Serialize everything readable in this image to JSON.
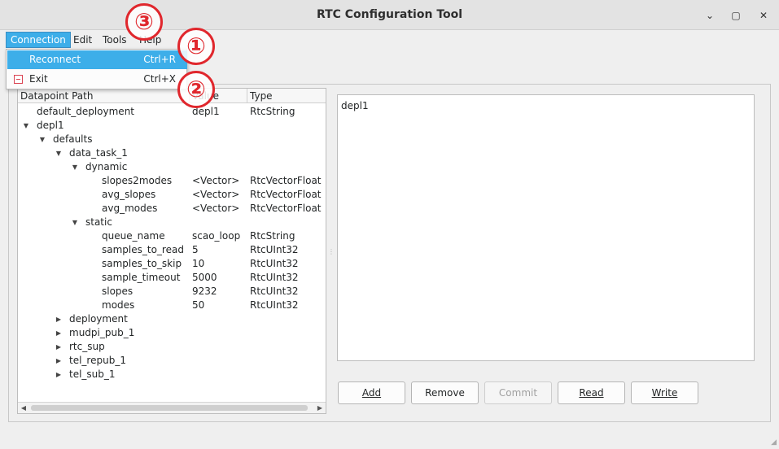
{
  "window": {
    "title": "RTC Configuration Tool",
    "minimize": "⌄",
    "maximize": "▢",
    "close": "✕"
  },
  "menubar": {
    "items": [
      "Connection",
      "Edit",
      "Tools",
      "Help"
    ],
    "active": "Connection"
  },
  "connection_menu": {
    "items": [
      {
        "label": "Reconnect",
        "shortcut": "Ctrl+R",
        "highlighted": true
      },
      {
        "label": "Exit",
        "shortcut": "Ctrl+X",
        "icon": "exit-icon"
      }
    ]
  },
  "tree": {
    "headers": [
      "Datapoint Path",
      "Value",
      "Type"
    ],
    "rows": [
      {
        "name": "default_deployment",
        "value": "depl1",
        "type": "RtcString",
        "depth": 0,
        "arrow": ""
      },
      {
        "name": "depl1",
        "value": "",
        "type": "",
        "depth": 0,
        "arrow": "▼"
      },
      {
        "name": "defaults",
        "value": "",
        "type": "",
        "depth": 1,
        "arrow": "▼"
      },
      {
        "name": "data_task_1",
        "value": "",
        "type": "",
        "depth": 2,
        "arrow": "▼"
      },
      {
        "name": "dynamic",
        "value": "",
        "type": "",
        "depth": 3,
        "arrow": "▼"
      },
      {
        "name": "slopes2modes",
        "value": "<Vector>",
        "type": "RtcVectorFloat",
        "depth": 4,
        "arrow": ""
      },
      {
        "name": "avg_slopes",
        "value": "<Vector>",
        "type": "RtcVectorFloat",
        "depth": 4,
        "arrow": ""
      },
      {
        "name": "avg_modes",
        "value": "<Vector>",
        "type": "RtcVectorFloat",
        "depth": 4,
        "arrow": ""
      },
      {
        "name": "static",
        "value": "",
        "type": "",
        "depth": 3,
        "arrow": "▼"
      },
      {
        "name": "queue_name",
        "value": "scao_loop",
        "type": "RtcString",
        "depth": 4,
        "arrow": ""
      },
      {
        "name": "samples_to_read",
        "value": "5",
        "type": "RtcUInt32",
        "depth": 4,
        "arrow": ""
      },
      {
        "name": "samples_to_skip",
        "value": "10",
        "type": "RtcUInt32",
        "depth": 4,
        "arrow": ""
      },
      {
        "name": "sample_timeout",
        "value": "5000",
        "type": "RtcUInt32",
        "depth": 4,
        "arrow": ""
      },
      {
        "name": "slopes",
        "value": "9232",
        "type": "RtcUInt32",
        "depth": 4,
        "arrow": ""
      },
      {
        "name": "modes",
        "value": "50",
        "type": "RtcUInt32",
        "depth": 4,
        "arrow": ""
      },
      {
        "name": "deployment",
        "value": "",
        "type": "",
        "depth": 2,
        "arrow": "▶"
      },
      {
        "name": "mudpi_pub_1",
        "value": "",
        "type": "",
        "depth": 2,
        "arrow": "▶"
      },
      {
        "name": "rtc_sup",
        "value": "",
        "type": "",
        "depth": 2,
        "arrow": "▶"
      },
      {
        "name": "tel_repub_1",
        "value": "",
        "type": "",
        "depth": 2,
        "arrow": "▶"
      },
      {
        "name": "tel_sub_1",
        "value": "",
        "type": "",
        "depth": 2,
        "arrow": "▶"
      }
    ],
    "scroll_left": "◀",
    "scroll_right": "▶"
  },
  "editor": {
    "text": "depl1"
  },
  "buttons": {
    "add": "Add",
    "remove": "Remove",
    "commit": "Commit",
    "read": "Read",
    "write": "Write"
  },
  "markers": [
    "③",
    "①",
    "②"
  ]
}
